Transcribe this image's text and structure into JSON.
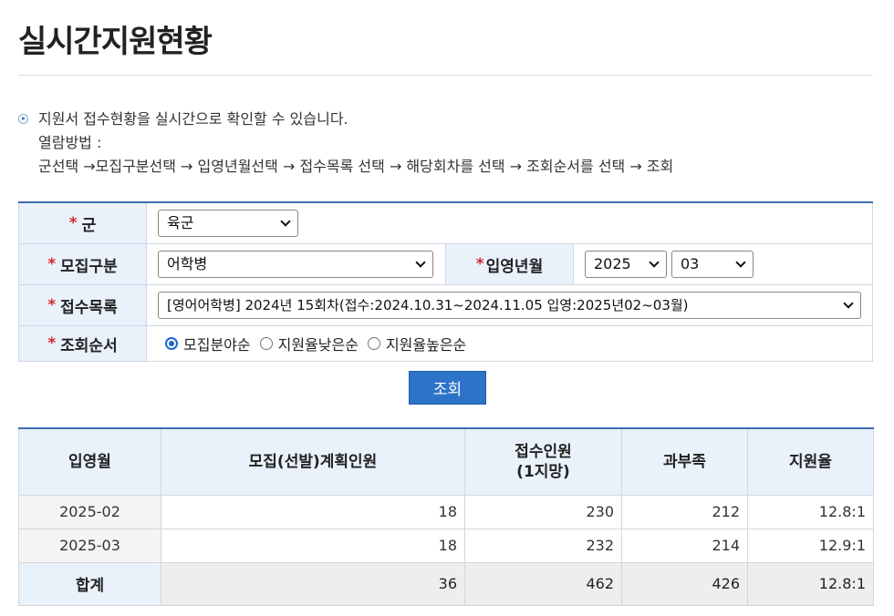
{
  "page": {
    "title": "실시간지원현황"
  },
  "info": {
    "lines": [
      "지원서 접수현황을 실시간으로 확인할 수 있습니다.",
      "열람방법 :",
      "군선택 →모집구분선택 → 입영년월선택 → 접수목록 선택 → 해당회차를 선택 → 조회순서를 선택 → 조회"
    ]
  },
  "form": {
    "required_mark": "*",
    "branch": {
      "label": "군",
      "value": "육군"
    },
    "category": {
      "label": "모집구분",
      "value": "어학병"
    },
    "enlist": {
      "label": "입영년월",
      "year": "2025",
      "month": "03"
    },
    "list": {
      "label": "접수목록",
      "value": "[영어어학병] 2024년 15회차(접수:2024.10.31~2024.11.05 입영:2025년02~03월)"
    },
    "order": {
      "label": "조회순서",
      "options": [
        "모집분야순",
        "지원율낮은순",
        "지원율높은순"
      ],
      "selected_index": 0
    }
  },
  "search_button": "조회",
  "table": {
    "headers": [
      "입영월",
      "모집(선발)계획인원",
      "접수인원\n(1지망)",
      "과부족",
      "지원율"
    ],
    "rows": [
      [
        "2025-02",
        "18",
        "230",
        "212",
        "12.8:1"
      ],
      [
        "2025-03",
        "18",
        "232",
        "214",
        "12.9:1"
      ]
    ],
    "total": [
      "합계",
      "36",
      "462",
      "426",
      "12.8:1"
    ]
  }
}
